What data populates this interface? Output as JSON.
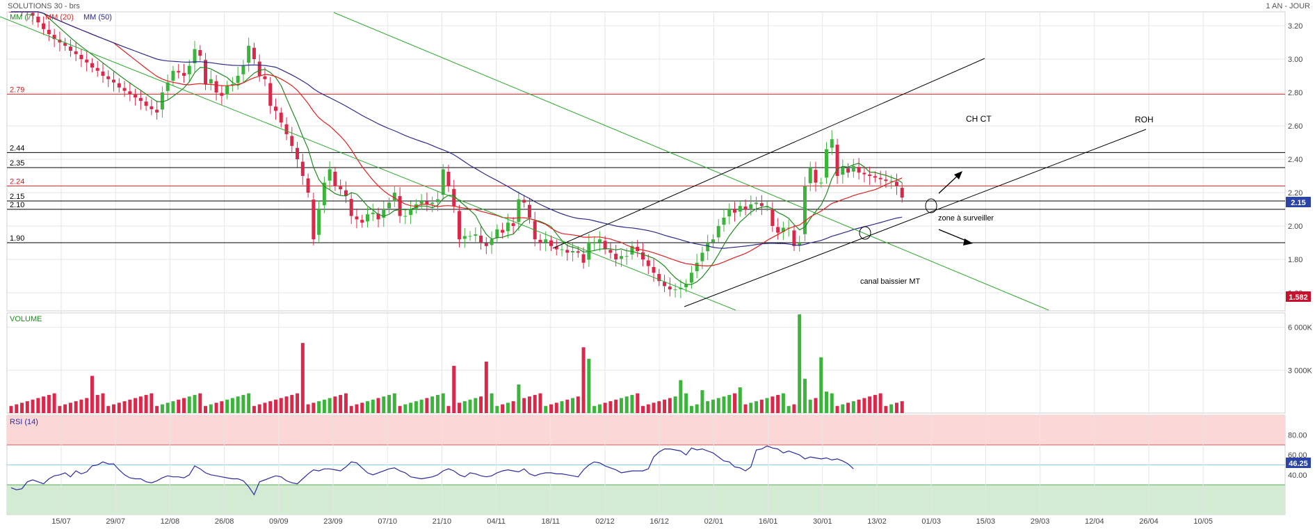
{
  "header": {
    "title": "SOLUTIONS 30 - brs",
    "period": "1 AN - JOUR"
  },
  "legend": {
    "ma7": "MM (7)",
    "ma20": "MM (20)",
    "ma50": "MM (50)"
  },
  "colors": {
    "up": "#3cb43c",
    "down": "#d9294a",
    "ma7": "#1f8a1f",
    "ma20": "#e02020",
    "ma50": "#2a2a8c",
    "rsi": "#2a2aa0",
    "grid": "#e6e6e6",
    "label_blue": "#2a44a8",
    "label_red": "#c8102e"
  },
  "chart_data": [
    {
      "type": "candlestick",
      "title": "SOLUTIONS 30 - brs",
      "period": "1 AN - JOUR",
      "ylim": [
        1.5,
        3.32
      ],
      "yticks": [
        "3.20",
        "3.00",
        "2.80",
        "2.60",
        "2.40",
        "2.20",
        "2.00",
        "1.80",
        "1.60"
      ],
      "x_ticks": [
        "15/07",
        "29/07",
        "12/08",
        "26/08",
        "09/09",
        "23/09",
        "07/10",
        "21/10",
        "04/11",
        "18/11",
        "02/12",
        "16/12",
        "02/01",
        "16/01",
        "30/01",
        "13/02",
        "01/03",
        "15/03",
        "29/03",
        "12/04",
        "26/04",
        "10/05"
      ],
      "closes": [
        3.36,
        3.32,
        3.3,
        3.28,
        3.26,
        3.22,
        3.18,
        3.15,
        3.12,
        3.1,
        3.08,
        3.05,
        3.03,
        3.0,
        2.98,
        2.95,
        2.93,
        2.9,
        2.88,
        2.86,
        2.83,
        2.81,
        2.79,
        2.77,
        2.75,
        2.72,
        2.7,
        2.68,
        2.8,
        2.86,
        2.93,
        2.92,
        2.9,
        2.96,
        3.06,
        3.02,
        2.85,
        2.88,
        2.8,
        2.78,
        2.84,
        2.85,
        2.9,
        2.96,
        3.08,
        3.0,
        2.9,
        2.88,
        2.72,
        2.69,
        2.62,
        2.55,
        2.48,
        2.4,
        2.3,
        2.2,
        1.92,
        2.1,
        2.26,
        2.34,
        2.24,
        2.22,
        2.18,
        2.06,
        2.04,
        2.02,
        2.07,
        2.08,
        2.04,
        2.1,
        2.14,
        2.2,
        2.06,
        2.06,
        2.1,
        2.13,
        2.15,
        2.13,
        2.14,
        2.16,
        2.34,
        2.24,
        2.12,
        1.92,
        1.94,
        1.94,
        1.95,
        1.9,
        1.88,
        1.92,
        1.98,
        1.96,
        2.02,
        2.0,
        2.16,
        2.14,
        2.05,
        1.92,
        1.9,
        1.92,
        1.88,
        1.86,
        1.86,
        1.84,
        1.85,
        1.84,
        1.78,
        1.9,
        1.9,
        1.92,
        1.86,
        1.84,
        1.8,
        1.82,
        1.82,
        1.88,
        1.85,
        1.8,
        1.76,
        1.72,
        1.67,
        1.64,
        1.62,
        1.62,
        1.63,
        1.65,
        1.72,
        1.78,
        1.84,
        1.9,
        1.92,
        2.0,
        2.05,
        2.1,
        2.08,
        2.12,
        2.1,
        2.13,
        2.14,
        2.12,
        2.12,
        2.0,
        1.96,
        1.99,
        1.99,
        1.88,
        1.9,
        2.24,
        2.35,
        2.26,
        2.26,
        2.46,
        2.52,
        2.3,
        2.35,
        2.32,
        2.36,
        2.32,
        2.31,
        2.3,
        2.29,
        2.28,
        2.27,
        2.27,
        2.24,
        2.17
      ]
    },
    {
      "type": "bar",
      "title": "VOLUME",
      "yticks": [
        "6 000K",
        "3 000K"
      ],
      "ylim": [
        0,
        7000
      ]
    },
    {
      "type": "line",
      "title": "RSI (14)",
      "ylim": [
        0,
        100
      ],
      "yticks": [
        "80.00",
        "60.00",
        "40.00"
      ],
      "current": "46.25",
      "values": [
        27,
        25,
        26,
        33,
        35,
        33,
        31,
        36,
        39,
        40,
        42,
        38,
        44,
        41,
        43,
        49,
        50,
        53,
        51,
        51,
        45,
        40,
        37,
        36,
        36,
        33,
        32,
        34,
        37,
        39,
        38,
        38,
        37,
        40,
        49,
        46,
        42,
        40,
        39,
        38,
        37,
        36,
        36,
        34,
        28,
        20,
        33,
        35,
        37,
        39,
        38,
        34,
        32,
        31,
        36,
        41,
        45,
        44,
        46,
        46,
        45,
        44,
        48,
        53,
        52,
        47,
        42,
        40,
        42,
        44,
        46,
        47,
        44,
        42,
        38,
        37,
        36,
        37,
        38,
        40,
        44,
        46,
        44,
        40,
        38,
        42,
        41,
        39,
        38,
        39,
        42,
        44,
        45,
        44,
        43,
        46,
        41,
        39,
        41,
        42,
        42,
        41,
        41,
        40,
        39,
        38,
        45,
        50,
        53,
        52,
        49,
        47,
        45,
        42,
        43,
        44,
        44,
        44,
        46,
        58,
        63,
        66,
        66,
        65,
        64,
        60,
        67,
        65,
        66,
        64,
        62,
        58,
        54,
        53,
        48,
        47,
        44,
        48,
        65,
        66,
        69,
        67,
        66,
        62,
        64,
        62,
        60,
        56,
        58,
        57,
        56,
        57,
        55,
        56,
        54,
        51,
        46
      ],
      "overbought": 70,
      "oversold": 30
    }
  ],
  "price": {
    "current_label": "2.15",
    "last_label": "1.582"
  },
  "levels": [
    {
      "label": "2.79",
      "value": 2.79,
      "color": "red"
    },
    {
      "label": "2.44",
      "value": 2.44,
      "color": "black"
    },
    {
      "label": "2.35",
      "value": 2.35,
      "color": "black"
    },
    {
      "label": "2.24",
      "value": 2.24,
      "color": "red"
    },
    {
      "label": "2.15",
      "value": 2.15,
      "color": "black"
    },
    {
      "label": "2.10",
      "value": 2.1,
      "color": "black"
    },
    {
      "label": "1.90",
      "value": 1.9,
      "color": "black"
    }
  ],
  "annotations": {
    "ch_ct": "CH  CT",
    "roh": "ROH",
    "zone": "zone à surveiller",
    "canal": "canal baissier MT"
  },
  "volume": {
    "title": "VOLUME"
  },
  "rsi": {
    "title": "RSI (14)",
    "current_label": "46.25"
  }
}
